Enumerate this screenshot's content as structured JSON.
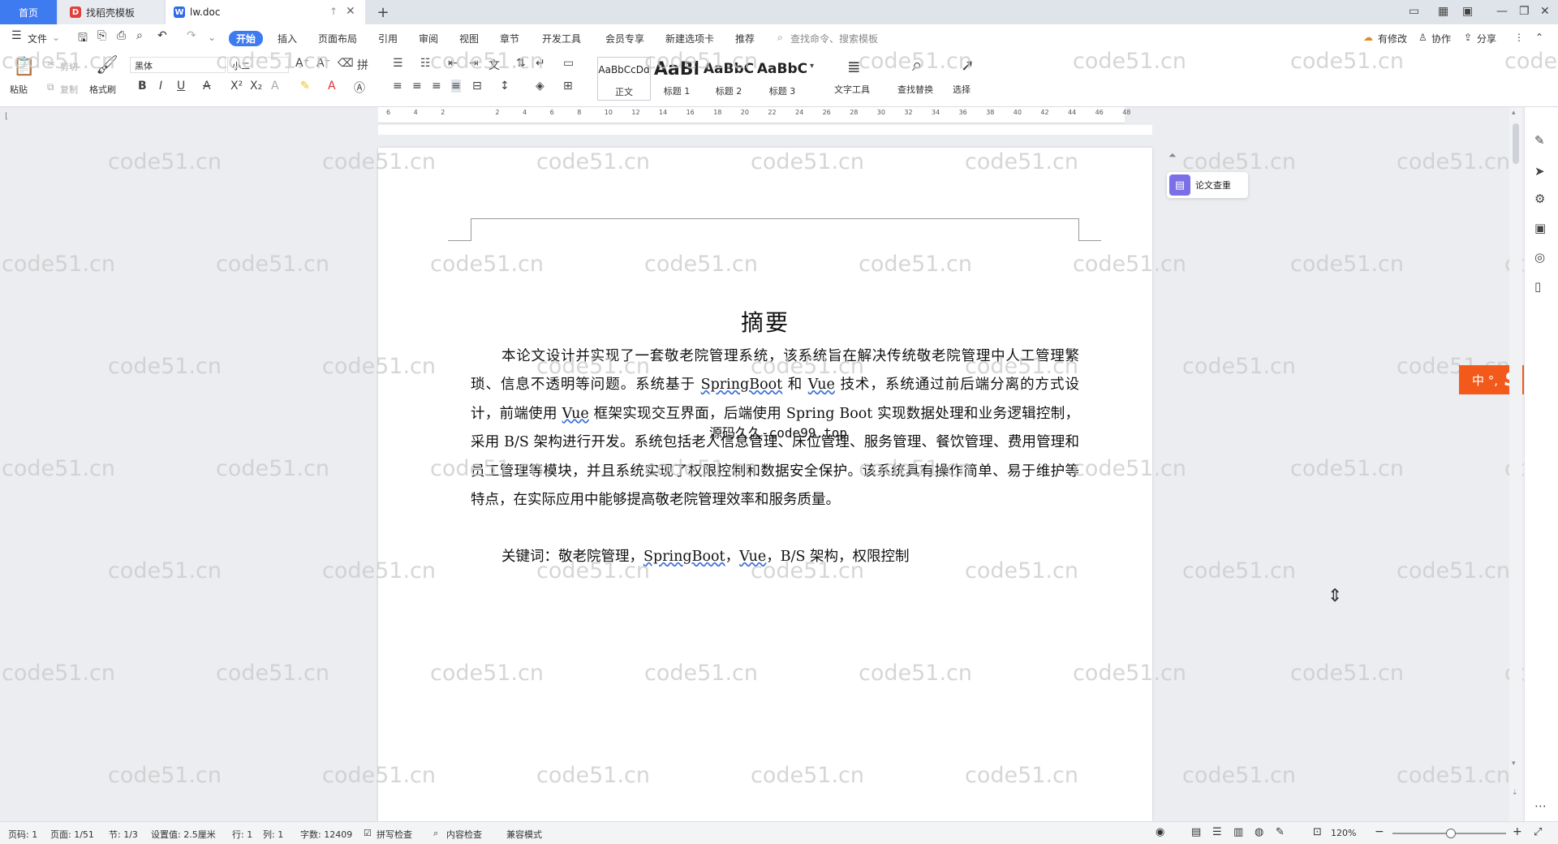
{
  "tabs": {
    "home": "首页",
    "templates": "找稻壳模板",
    "document": "lw.doc",
    "add": "+"
  },
  "menus": {
    "file": "文件",
    "items": [
      "开始",
      "插入",
      "页面布局",
      "引用",
      "审阅",
      "视图",
      "章节",
      "开发工具",
      "会员专享",
      "新建选项卡",
      "推荐"
    ],
    "search_placeholder": "查找命令、搜索模板",
    "right": [
      "有修改",
      "协作",
      "分享"
    ]
  },
  "ribbon": {
    "paste": "粘贴",
    "cut": "剪切",
    "copy": "复制",
    "format_painter": "格式刷",
    "font_name": "黑体",
    "font_size": "小二",
    "styles": [
      {
        "sample": "AaBbCcDd",
        "name": "正文"
      },
      {
        "sample": "AaBl",
        "name": "标题 1"
      },
      {
        "sample": "AaBbC",
        "name": "标题 2"
      },
      {
        "sample": "AaBbC",
        "name": "标题 3"
      }
    ],
    "text_tools": "文字工具",
    "find_replace": "查找替换",
    "select": "选择"
  },
  "ruler": {
    "ticks": [
      "6",
      "4",
      "2",
      "",
      "2",
      "4",
      "6",
      "8",
      "10",
      "12",
      "14",
      "16",
      "18",
      "20",
      "22",
      "24",
      "26",
      "28",
      "30",
      "32",
      "34",
      "36",
      "38",
      "40",
      "42",
      "44",
      "46",
      "48"
    ]
  },
  "document": {
    "title": "摘要",
    "abstract_parts": [
      "本论文设计并实现了一套敬老院管理系统，该系统旨在解决传统敬老院管理中人工管理繁琐、信息不透明等问题。系统基于 ",
      "SpringBoot",
      " 和 ",
      "Vue",
      " 技术，系统通过前后端分离的方式设计，前端使用 ",
      "Vue",
      " 框架实现交互界面，后端使用 Spring Boot 实现数据处理和业务逻辑控制，采用 B/S 架构进行开发。系统包括老人信息管理、床位管理、服务管理、餐饮管理、费用管理和员工管理等模块，并且系统实现了权限控制和数据安全保护。该系统具有操作简单、易于维护等特点，在实际应用中能够提高敬老院管理效率和服务质量。"
    ],
    "keywords_label": "关键词：",
    "keywords_parts": [
      "敬老院管理，",
      "SpringBoot",
      "，",
      "Vue",
      "，B/S 架构，权限控制"
    ],
    "source_overlay": "源码久久-code99.top"
  },
  "watermark": "code51.cn",
  "sidebar": {
    "paper_check": "论文查重"
  },
  "ime": {
    "label": "中 °,"
  },
  "status": {
    "page_code": "页码: 1",
    "page": "页面: 1/51",
    "section": "节: 1/3",
    "setting": "设置值: 2.5厘米",
    "row": "行: 1",
    "col": "列: 1",
    "words": "字数: 12409",
    "spell": "拼写检查",
    "content_check": "内容检查",
    "compat": "兼容模式",
    "zoom": "120%"
  },
  "colors": {
    "accent": "#3e7bf0",
    "ime": "#f2591a",
    "paper_check_icon": "#7b6fe8"
  }
}
